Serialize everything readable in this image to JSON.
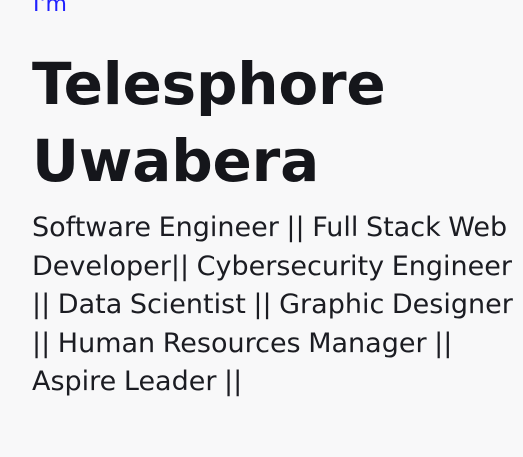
{
  "hero": {
    "intro": "I'm",
    "name": "Telesphore Uwabera",
    "roles": "Software Engineer || Full Stack Web Developer|| Cybersecurity Engineer || Data Scientist || Graphic Designer || Human Resources Manager || Aspire Leader ||"
  },
  "colors": {
    "background": "#f8f8f9",
    "intro": "#1f20ff",
    "text": "#15161b"
  }
}
